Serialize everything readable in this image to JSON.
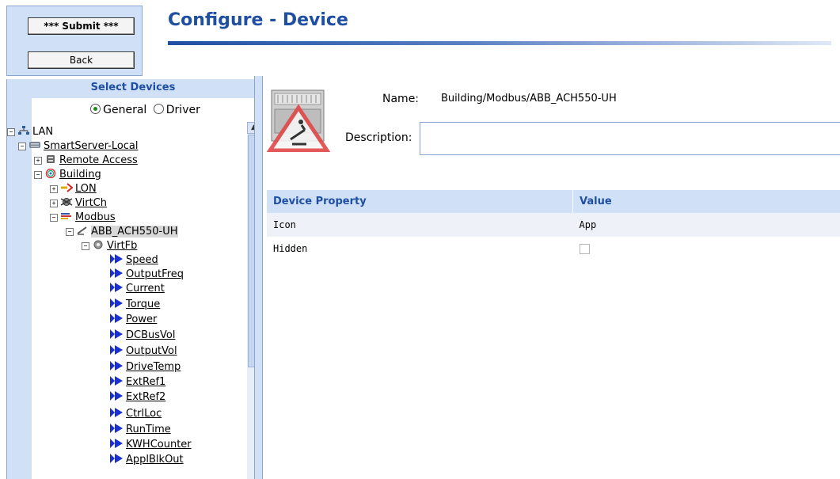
{
  "header": {
    "title": "Configure - Device",
    "submit_label": "*** Submit ***",
    "back_label": "Back"
  },
  "tree": {
    "header": "Select Devices",
    "radio_general": "General",
    "radio_driver": "Driver",
    "selected_radio": "General",
    "nodes": [
      {
        "label": "LAN",
        "icon": "network-icon"
      },
      {
        "label": "SmartServer-Local",
        "icon": "server-icon"
      },
      {
        "label": "Remote Access",
        "icon": "phone-icon"
      },
      {
        "label": "Building",
        "icon": "app-icon"
      },
      {
        "label": "LON",
        "icon": "lon-icon"
      },
      {
        "label": "VirtCh",
        "icon": "virtual-channel-icon"
      },
      {
        "label": "Modbus",
        "icon": "modbus-icon"
      },
      {
        "label": "ABB_ACH550-UH",
        "icon": "device-icon"
      },
      {
        "label": "VirtFb",
        "icon": "gear-icon"
      },
      {
        "label": "Speed"
      },
      {
        "label": "OutputFreq"
      },
      {
        "label": "Current"
      },
      {
        "label": "Torque"
      },
      {
        "label": "Power"
      },
      {
        "label": "DCBusVol"
      },
      {
        "label": "OutputVol"
      },
      {
        "label": "DriveTemp"
      },
      {
        "label": "ExtRef1"
      },
      {
        "label": "ExtRef2"
      },
      {
        "label": "CtrlLoc"
      },
      {
        "label": "RunTime"
      },
      {
        "label": "KWHCounter"
      },
      {
        "label": "ApplBlkOut"
      }
    ]
  },
  "details": {
    "name_label": "Name:",
    "name_value": "Building/Modbus/ABB_ACH550-UH",
    "description_label": "Description:",
    "description_value": ""
  },
  "table": {
    "col_property": "Device Property",
    "col_value": "Value",
    "rows": [
      {
        "property": "Icon",
        "value": "App"
      },
      {
        "property": "Hidden",
        "value": ""
      }
    ]
  },
  "colors": {
    "accent": "#1f4fa3",
    "panel": "#cfe0f7",
    "tree_arrow": "#1a2fd0"
  }
}
